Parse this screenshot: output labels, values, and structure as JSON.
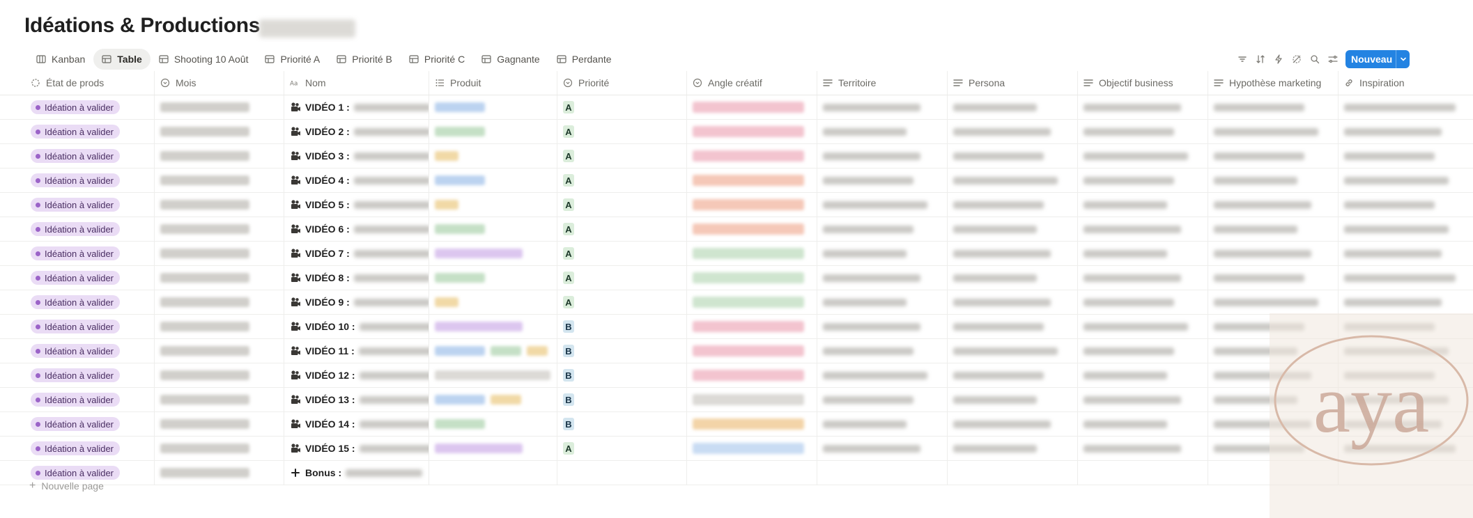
{
  "page": {
    "title": "Idéations & Productions"
  },
  "tabs": [
    {
      "label": "Kanban",
      "icon": "kanban-icon",
      "active": false
    },
    {
      "label": "Table",
      "icon": "table-icon",
      "active": true
    },
    {
      "label": "Shooting 10 Août",
      "icon": "table-icon",
      "active": false
    },
    {
      "label": "Priorité A",
      "icon": "table-icon",
      "active": false
    },
    {
      "label": "Priorité B",
      "icon": "table-icon",
      "active": false
    },
    {
      "label": "Priorité C",
      "icon": "table-icon",
      "active": false
    },
    {
      "label": "Gagnante",
      "icon": "table-icon",
      "active": false
    },
    {
      "label": "Perdante",
      "icon": "table-icon",
      "active": false
    }
  ],
  "toolbar": {
    "icons": [
      "filter-icon",
      "sort-icon",
      "automation-icon",
      "hide-icon",
      "search-icon",
      "settings-icon"
    ],
    "new_label": "Nouveau"
  },
  "columns": [
    {
      "label": "État de prods",
      "icon": "status-icon"
    },
    {
      "label": "Mois",
      "icon": "select-icon"
    },
    {
      "label": "Nom",
      "icon": "title-icon"
    },
    {
      "label": "Produit",
      "icon": "multiselect-icon"
    },
    {
      "label": "Priorité",
      "icon": "select-icon"
    },
    {
      "label": "Angle créatif",
      "icon": "select-icon"
    },
    {
      "label": "Territoire",
      "icon": "text-icon"
    },
    {
      "label": "Persona",
      "icon": "text-icon"
    },
    {
      "label": "Objectif business",
      "icon": "text-icon"
    },
    {
      "label": "Hypothèse marketing",
      "icon": "text-icon"
    },
    {
      "label": "Inspiration",
      "icon": "link-icon"
    }
  ],
  "rows": [
    {
      "status": "Idéation à valider",
      "nom": "VIDÉO 1 :",
      "priorite": "A",
      "produit_colors": [
        "#bcd3f0"
      ],
      "angle_color": "#f3c4cf"
    },
    {
      "status": "Idéation à valider",
      "nom": "VIDÉO 2 :",
      "priorite": "A",
      "produit_colors": [
        "#c5e0c6"
      ],
      "angle_color": "#f3c4cf"
    },
    {
      "status": "Idéation à valider",
      "nom": "VIDÉO 3 :",
      "priorite": "A",
      "produit_colors": [
        "#f1d9a6"
      ],
      "angle_color": "#f3c4cf"
    },
    {
      "status": "Idéation à valider",
      "nom": "VIDÉO 4 :",
      "priorite": "A",
      "produit_colors": [
        "#bcd3f0"
      ],
      "angle_color": "#f5c8b8"
    },
    {
      "status": "Idéation à valider",
      "nom": "VIDÉO 5 :",
      "priorite": "A",
      "produit_colors": [
        "#f1d9a6"
      ],
      "angle_color": "#f5c8b8"
    },
    {
      "status": "Idéation à valider",
      "nom": "VIDÉO 6 :",
      "priorite": "A",
      "produit_colors": [
        "#c5e0c6"
      ],
      "angle_color": "#f5c8b8"
    },
    {
      "status": "Idéation à valider",
      "nom": "VIDÉO 7 :",
      "priorite": "A",
      "produit_colors": [
        "#dcc6ef"
      ],
      "angle_color": "#cfe5cf"
    },
    {
      "status": "Idéation à valider",
      "nom": "VIDÉO 8 :",
      "priorite": "A",
      "produit_colors": [
        "#c5e0c6"
      ],
      "angle_color": "#cfe5cf"
    },
    {
      "status": "Idéation à valider",
      "nom": "VIDÉO 9 :",
      "priorite": "A",
      "produit_colors": [
        "#f1d9a6"
      ],
      "angle_color": "#cfe5cf"
    },
    {
      "status": "Idéation à valider",
      "nom": "VIDÉO 10 :",
      "priorite": "B",
      "produit_colors": [
        "#dcc6ef"
      ],
      "angle_color": "#f3c4cf"
    },
    {
      "status": "Idéation à valider",
      "nom": "VIDÉO 11 :",
      "priorite": "B",
      "produit_colors": [
        "#bcd3f0",
        "#c5e0c6",
        "#f1d9a6"
      ],
      "angle_color": "#f3c4cf"
    },
    {
      "status": "Idéation à valider",
      "nom": "VIDÉO 12 :",
      "priorite": "B",
      "produit_colors": [
        "#dcdad6"
      ],
      "angle_color": "#f3c4cf"
    },
    {
      "status": "Idéation à valider",
      "nom": "VIDÉO 13 :",
      "priorite": "B",
      "produit_colors": [
        "#bcd3f0",
        "#f1d9a6"
      ],
      "angle_color": "#dcdad6"
    },
    {
      "status": "Idéation à valider",
      "nom": "VIDÉO 14 :",
      "priorite": "B",
      "produit_colors": [
        "#c5e0c6"
      ],
      "angle_color": "#f3d4a8"
    },
    {
      "status": "Idéation à valider",
      "nom": "VIDÉO 15 :",
      "priorite": "A",
      "produit_colors": [
        "#dcc6ef"
      ],
      "angle_color": "#c9dcf3"
    },
    {
      "status": "Idéation à valider",
      "nom": "Bonus :",
      "priorite": "",
      "produit_colors": [],
      "angle_color": "",
      "is_bonus": true
    }
  ],
  "footer": {
    "new_page_label": "Nouvelle page"
  },
  "watermark": {
    "text": "aya"
  },
  "colors": {
    "accent": "#2383e2",
    "status_bg": "#eadcf5",
    "status_dot": "#9b63c8"
  }
}
